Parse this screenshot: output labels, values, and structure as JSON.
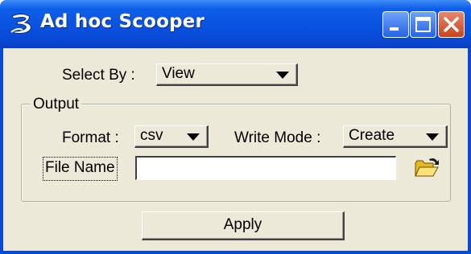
{
  "window": {
    "title": "Ad hoc Scooper",
    "app_icon": "bentley-b-icon",
    "controls": [
      "minimize-icon",
      "maximize-icon",
      "close-icon"
    ]
  },
  "select_by": {
    "label": "Select By :",
    "value": "View"
  },
  "output": {
    "group_title": "Output",
    "format_label": "Format :",
    "format_value": "csv",
    "write_mode_label": "Write Mode :",
    "write_mode_value": "Create",
    "file_name_label": "File Name",
    "file_name_value": "",
    "browse_icon": "open-folder-icon"
  },
  "apply_label": "Apply",
  "colors": {
    "titlebar": "#0a52e0",
    "client_bg": "#ece9d8",
    "close_button": "#c9431c"
  }
}
